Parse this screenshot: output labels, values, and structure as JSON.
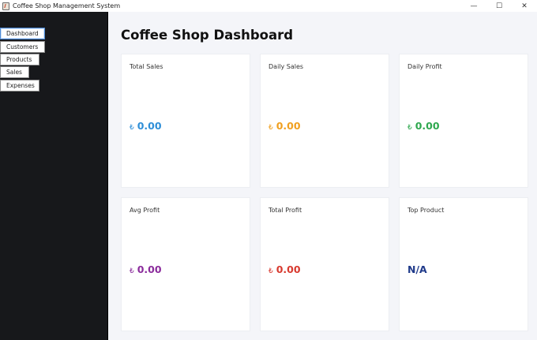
{
  "window": {
    "title": "Coffee Shop Management System",
    "minimize_glyph": "—",
    "maximize_glyph": "☐",
    "close_glyph": "✕"
  },
  "sidebar": {
    "items": [
      {
        "label": "Dashboard",
        "active": true
      },
      {
        "label": "Customers"
      },
      {
        "label": "Products"
      },
      {
        "label": "Sales"
      },
      {
        "label": "Expenses"
      }
    ]
  },
  "main": {
    "title": "Coffee Shop Dashboard",
    "cards": [
      {
        "label": "Total Sales",
        "currency": "₺",
        "value": "0.00",
        "color": "#2f8fd8"
      },
      {
        "label": "Daily Sales",
        "currency": "₺",
        "value": "0.00",
        "color": "#f0a020"
      },
      {
        "label": "Daily Profit",
        "currency": "₺",
        "value": "0.00",
        "color": "#2fa84f"
      },
      {
        "label": "Avg Profit",
        "currency": "₺",
        "value": "0.00",
        "color": "#8b2c9c"
      },
      {
        "label": "Total Profit",
        "currency": "₺",
        "value": "0.00",
        "color": "#d83a2f"
      },
      {
        "label": "Top Product",
        "currency": "",
        "value": "N/A",
        "color": "#1f3a8a"
      }
    ]
  }
}
